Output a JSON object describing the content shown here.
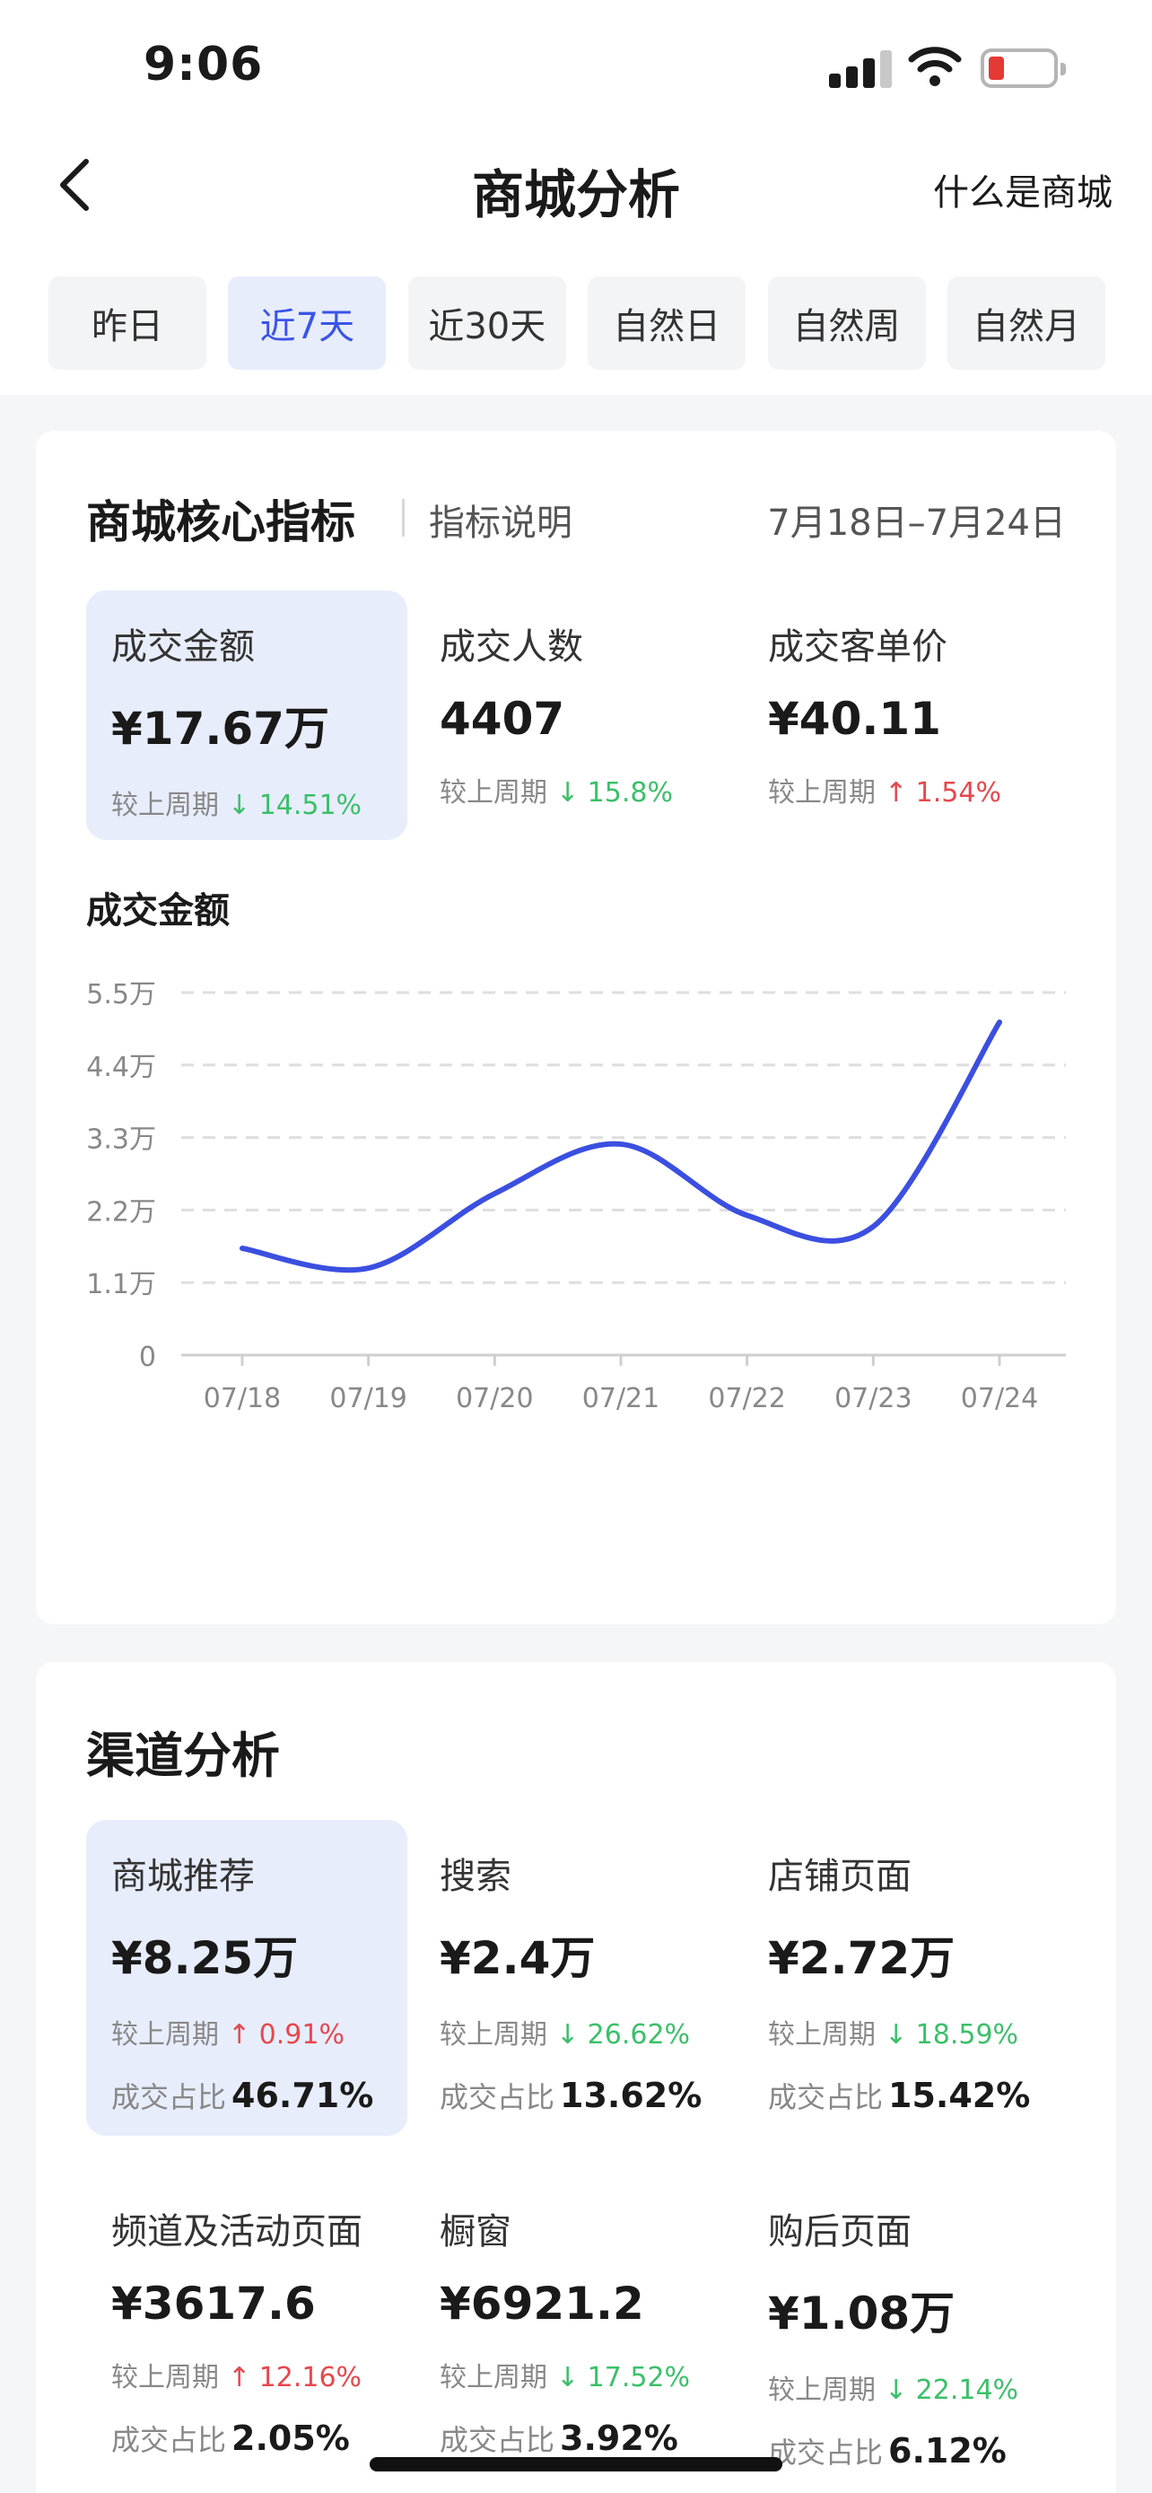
{
  "status_bar": {
    "time": "9:06"
  },
  "nav": {
    "title": "商城分析",
    "help_link": "什么是商城"
  },
  "tabs": [
    {
      "label": "昨日",
      "active": false
    },
    {
      "label": "近7天",
      "active": true
    },
    {
      "label": "近30天",
      "active": false
    },
    {
      "label": "自然日",
      "active": false
    },
    {
      "label": "自然周",
      "active": false
    },
    {
      "label": "自然月",
      "active": false
    }
  ],
  "core": {
    "title": "商城核心指标",
    "explain": "指标说明",
    "date_range": "7月18日–7月24日",
    "metrics": [
      {
        "label": "成交金额",
        "value": "¥17.67万",
        "compare_label": "较上周期",
        "change": "↓ 14.51%",
        "direction": "down",
        "selected": true
      },
      {
        "label": "成交人数",
        "value": "4407",
        "compare_label": "较上周期",
        "change": "↓ 15.8%",
        "direction": "down",
        "selected": false
      },
      {
        "label": "成交客单价",
        "value": "¥40.11",
        "compare_label": "较上周期",
        "change": "↑ 1.54%",
        "direction": "up",
        "selected": false
      }
    ]
  },
  "chart_data": {
    "type": "line",
    "title": "成交金额",
    "categories": [
      "07/18",
      "07/19",
      "07/20",
      "07/21",
      "07/22",
      "07/23",
      "07/24"
    ],
    "series": [
      {
        "values": [
          16200,
          13200,
          24500,
          32000,
          21200,
          19500,
          50500
        ],
        "color": "#3b4fe0"
      }
    ],
    "y_ticks": [
      "0",
      "1.1万",
      "2.2万",
      "3.3万",
      "4.4万",
      "5.5万"
    ],
    "ylim": [
      0,
      55000
    ],
    "grid": true,
    "smooth": true
  },
  "channel": {
    "title": "渠道分析",
    "share_label": "成交占比",
    "items": [
      {
        "label": "商城推荐",
        "value": "¥8.25万",
        "compare_label": "较上周期",
        "change": "↑ 0.91%",
        "direction": "up",
        "share": "46.71%",
        "selected": true
      },
      {
        "label": "搜索",
        "value": "¥2.4万",
        "compare_label": "较上周期",
        "change": "↓ 26.62%",
        "direction": "down",
        "share": "13.62%",
        "selected": false
      },
      {
        "label": "店铺页面",
        "value": "¥2.72万",
        "compare_label": "较上周期",
        "change": "↓ 18.59%",
        "direction": "down",
        "share": "15.42%",
        "selected": false
      },
      {
        "label": "频道及活动页面",
        "value": "¥3617.6",
        "compare_label": "较上周期",
        "change": "↑ 12.16%",
        "direction": "up",
        "share": "2.05%",
        "selected": false
      },
      {
        "label": "橱窗",
        "value": "¥6921.2",
        "compare_label": "较上周期",
        "change": "↓ 17.52%",
        "direction": "down",
        "share": "3.92%",
        "selected": false
      },
      {
        "label": "购后页面",
        "value": "¥1.08万",
        "compare_label": "较上周期",
        "change": "↓ 22.14%",
        "direction": "down",
        "share": "6.12%",
        "selected": false
      }
    ]
  },
  "colors": {
    "accent": "#3b55e6",
    "up": "#e5484d",
    "down": "#3cbf6a",
    "selected_bg": "#e8edfc"
  }
}
